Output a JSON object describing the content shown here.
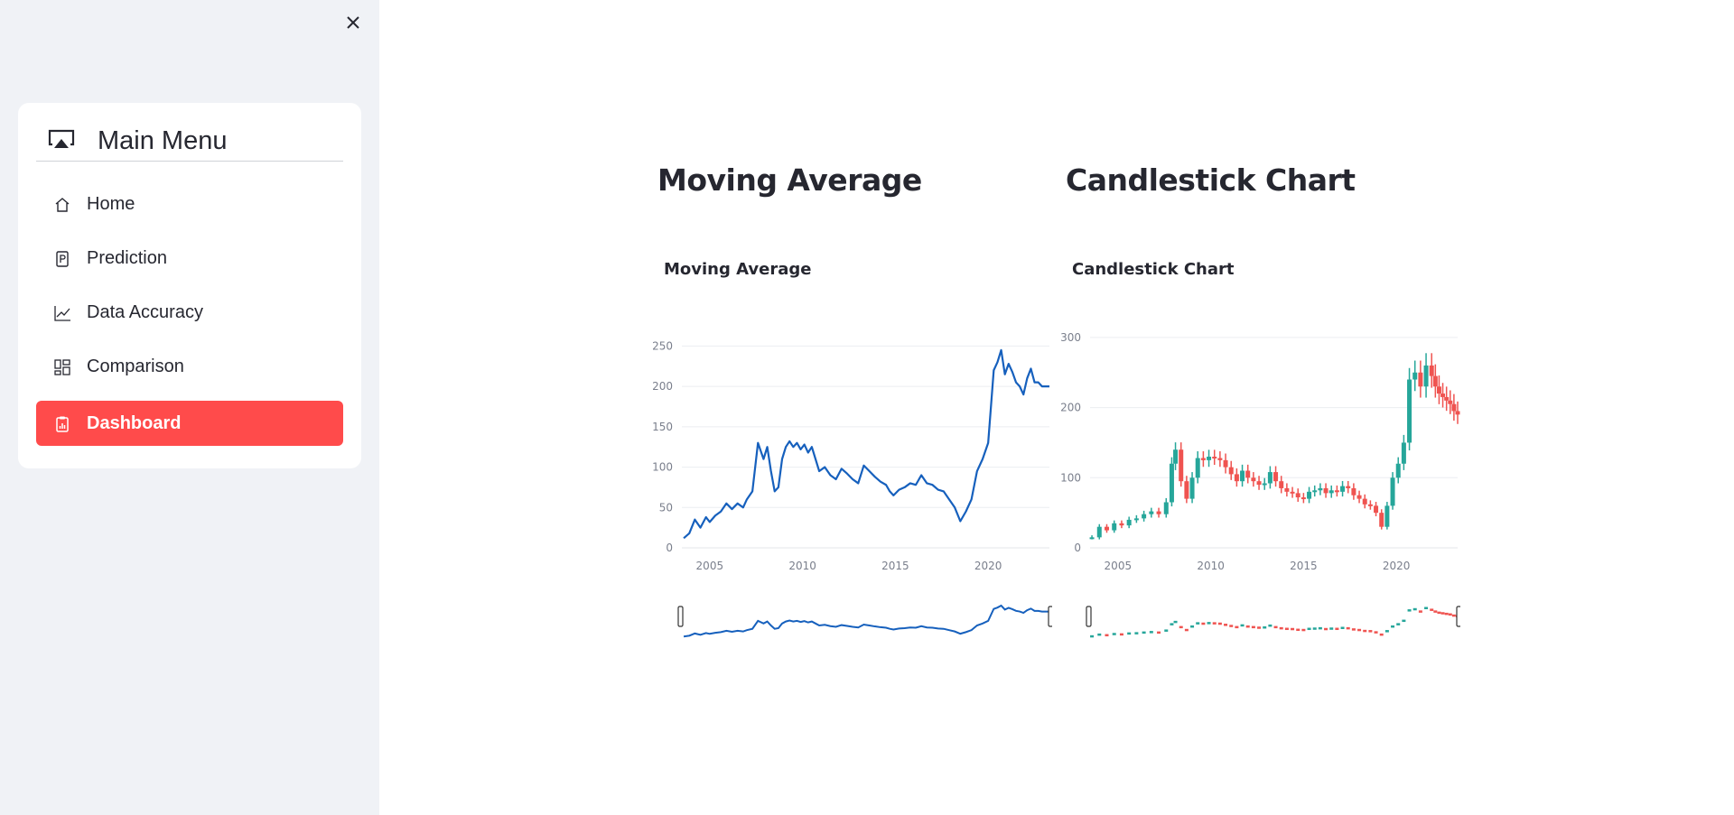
{
  "sidebar": {
    "menu_title": "Main Menu",
    "items": [
      {
        "label": "Home",
        "icon": "house-icon"
      },
      {
        "label": "Prediction",
        "icon": "p-square-icon"
      },
      {
        "label": "Data Accuracy",
        "icon": "graph-up-icon"
      },
      {
        "label": "Comparison",
        "icon": "grid-icon"
      },
      {
        "label": "Dashboard",
        "icon": "clipboard-data-icon",
        "active": true
      }
    ],
    "active_color": "#ff4b4b"
  },
  "main": {
    "sections": [
      {
        "title": "Moving Average"
      },
      {
        "title": "Candlestick Chart"
      }
    ]
  },
  "chart_data": [
    {
      "type": "line",
      "title": "Moving Average",
      "xlabel": "",
      "ylabel": "",
      "x_ticks": [
        "2005",
        "2010",
        "2015",
        "2020"
      ],
      "y_ticks": [
        0,
        50,
        100,
        150,
        200,
        250
      ],
      "xlim": [
        2003.5,
        2023.3
      ],
      "ylim": [
        0,
        265
      ],
      "grid": true,
      "range_slider": true,
      "line_color": "#1660bd",
      "series": [
        {
          "x": [
            2003.6,
            2003.9,
            2004.2,
            2004.5,
            2004.8,
            2005.0,
            2005.3,
            2005.6,
            2005.9,
            2006.2,
            2006.5,
            2006.8,
            2007.0,
            2007.3,
            2007.6,
            2007.9,
            2008.1,
            2008.3,
            2008.5,
            2008.7,
            2008.9,
            2009.1,
            2009.3,
            2009.5,
            2009.7,
            2009.9,
            2010.1,
            2010.3,
            2010.5,
            2010.7,
            2010.9,
            2011.2,
            2011.5,
            2011.8,
            2012.1,
            2012.4,
            2012.7,
            2013.0,
            2013.3,
            2013.6,
            2013.9,
            2014.2,
            2014.5,
            2014.7,
            2014.9,
            2015.2,
            2015.5,
            2015.8,
            2016.1,
            2016.4,
            2016.7,
            2017.0,
            2017.3,
            2017.6,
            2017.9,
            2018.2,
            2018.5,
            2018.8,
            2019.1,
            2019.4,
            2019.7,
            2020.0,
            2020.3,
            2020.5,
            2020.7,
            2020.9,
            2021.1,
            2021.3,
            2021.5,
            2021.7,
            2021.9,
            2022.1,
            2022.3,
            2022.5,
            2022.7,
            2022.9,
            2023.1,
            2023.3
          ],
          "y": [
            12,
            18,
            35,
            25,
            38,
            32,
            40,
            45,
            55,
            48,
            55,
            50,
            60,
            70,
            130,
            110,
            125,
            95,
            70,
            75,
            110,
            125,
            132,
            125,
            130,
            122,
            128,
            118,
            125,
            110,
            95,
            100,
            90,
            85,
            98,
            92,
            85,
            80,
            102,
            95,
            88,
            82,
            78,
            70,
            65,
            72,
            75,
            80,
            78,
            90,
            80,
            78,
            72,
            70,
            60,
            50,
            33,
            45,
            60,
            95,
            110,
            130,
            220,
            230,
            245,
            215,
            228,
            218,
            205,
            200,
            190,
            210,
            222,
            205,
            205,
            200,
            200,
            200
          ],
          "y_note": "read from chart"
        }
      ]
    },
    {
      "type": "candlestick",
      "title": "Candlestick Chart",
      "xlabel": "",
      "ylabel": "",
      "x_ticks": [
        "2005",
        "2010",
        "2015",
        "2020"
      ],
      "y_ticks": [
        0,
        100,
        200,
        300
      ],
      "xlim": [
        2003.5,
        2023.3
      ],
      "ylim": [
        0,
        305
      ],
      "grid": true,
      "range_slider": true,
      "increasing_color": "#26a69a",
      "decreasing_color": "#ef5350",
      "series": [
        {
          "x": [
            2003.6,
            2004.0,
            2004.4,
            2004.8,
            2005.2,
            2005.6,
            2006.0,
            2006.4,
            2006.8,
            2007.2,
            2007.6,
            2007.9,
            2008.1,
            2008.4,
            2008.7,
            2009.0,
            2009.3,
            2009.6,
            2009.9,
            2010.2,
            2010.5,
            2010.8,
            2011.1,
            2011.4,
            2011.7,
            2012.0,
            2012.3,
            2012.6,
            2012.9,
            2013.2,
            2013.5,
            2013.8,
            2014.1,
            2014.4,
            2014.7,
            2015.0,
            2015.3,
            2015.6,
            2015.9,
            2016.2,
            2016.5,
            2016.8,
            2017.1,
            2017.4,
            2017.7,
            2018.0,
            2018.3,
            2018.6,
            2018.9,
            2019.2,
            2019.5,
            2019.8,
            2020.1,
            2020.4,
            2020.7,
            2021.0,
            2021.3,
            2021.6,
            2021.9,
            2022.1,
            2022.3,
            2022.5,
            2022.7,
            2022.9,
            2023.1,
            2023.3
          ],
          "close": [
            15,
            30,
            25,
            35,
            32,
            40,
            42,
            48,
            52,
            48,
            65,
            120,
            140,
            95,
            70,
            100,
            128,
            125,
            130,
            128,
            125,
            115,
            105,
            95,
            110,
            100,
            95,
            90,
            92,
            108,
            95,
            85,
            80,
            78,
            72,
            70,
            80,
            82,
            85,
            78,
            82,
            80,
            88,
            85,
            75,
            70,
            62,
            60,
            50,
            30,
            60,
            100,
            120,
            150,
            240,
            250,
            230,
            260,
            245,
            230,
            220,
            215,
            210,
            205,
            195,
            190
          ],
          "y_note": "approximate daily closes, read from chart"
        }
      ]
    }
  ]
}
